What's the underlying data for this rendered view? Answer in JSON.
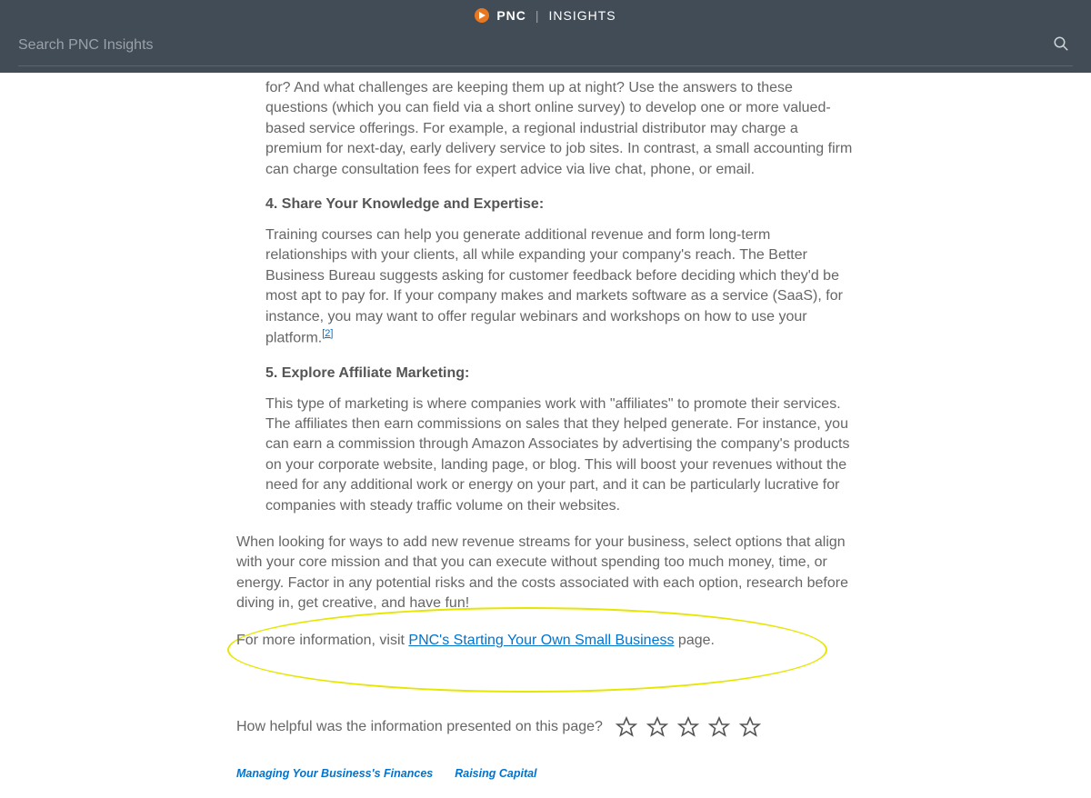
{
  "header": {
    "brand": "PNC",
    "brand_sub": "INSIGHTS",
    "search_placeholder": "Search PNC Insights"
  },
  "article": {
    "intro_fragment": "for? And what challenges are keeping them up at night? Use the answers to these questions (which you can field via a short online survey) to develop one or more valued-based service offerings. For example, a regional industrial distributor may charge a premium for next-day, early delivery service to job sites. In contrast, a small accounting firm can charge consultation fees for expert advice via live chat, phone, or email.",
    "sec4_head": "4. Share Your Knowledge and Expertise:",
    "sec4_body_a": "Training courses can help you generate additional revenue and form long-term relationships with your clients, all while expanding your company's reach. The Better Business Bureau suggests asking for customer feedback before deciding which they'd be most apt to pay for. If your company makes and markets software as a service (SaaS), for instance, you may want to offer regular webinars and workshops on how to use your platform.",
    "footnote2": "[2]",
    "sec5_head": "5. Explore Affiliate Marketing:",
    "sec5_body": "This type of marketing is where companies work with \"affiliates\" to promote their services. The affiliates then earn commissions on sales that they helped generate. For instance, you can earn a commission through Amazon Associates by advertising the company's products on your corporate website, landing page, or blog. This will boost your revenues without the need for any additional work or energy on your part, and it can be particularly lucrative for companies with steady traffic volume on their websites.",
    "closing": "When looking for ways to add new revenue streams for your business, select options that align with your core mission and that you can execute without spending too much money, time, or energy. Factor in any potential risks and the costs associated with each option, research before diving in, get creative, and have fun!",
    "cta_prefix": "For more information, visit ",
    "cta_link": "PNC's Starting Your Own Small Business",
    "cta_suffix": " page.",
    "rating_question": "How helpful was the information presented on this page?",
    "tags": [
      "Managing Your Business's Finances",
      "Raising Capital"
    ]
  }
}
